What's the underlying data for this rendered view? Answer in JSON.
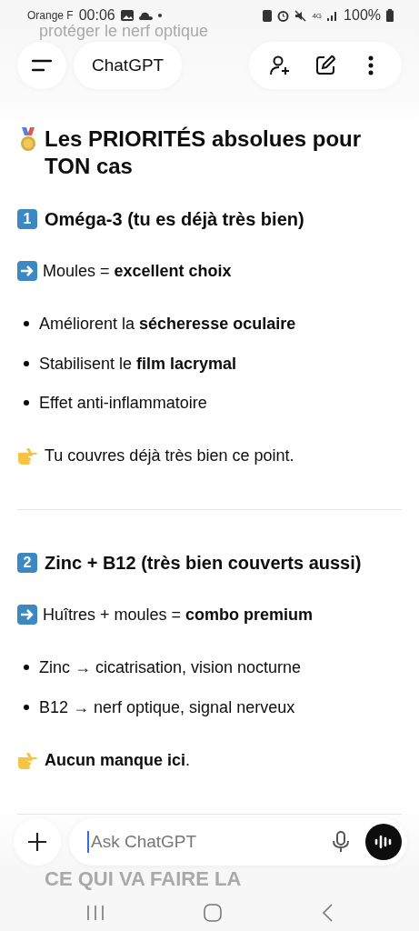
{
  "status_bar": {
    "carrier": "Orange F",
    "time": "00:06",
    "battery": "100%",
    "network": "4G"
  },
  "faded_top": "protéger le nerf optique",
  "header": {
    "title": "ChatGPT"
  },
  "heading": "Les PRIORITÉS absolues pour TON cas",
  "sections": [
    {
      "number": "1",
      "title": "Oméga-3 (tu es déjà très bien)",
      "lead": "Moules = **excellent choix**",
      "bullets": [
        "Améliorent la **sécheresse oculaire**",
        "Stabilisent le **film lacrymal**",
        "Effet anti-inflammatoire"
      ],
      "note": "Tu couvres déjà très bien ce point."
    },
    {
      "number": "2",
      "title": "Zinc + B12 (très bien couverts aussi)",
      "lead": "Huîtres + moules = **combo premium**",
      "bullets": [
        "Zinc → cicatrisation, vision nocturne",
        "B12 → nerf optique, signal nerveux"
      ],
      "note": "**Aucun manque ici**."
    }
  ],
  "faded_bottom": "CE QUI VA FAIRE LA",
  "composer": {
    "placeholder": "Ask ChatGPT"
  }
}
